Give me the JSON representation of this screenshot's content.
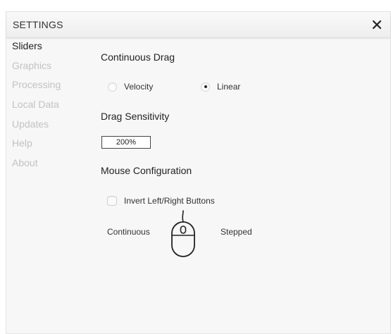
{
  "dialog": {
    "title": "SETTINGS",
    "close_icon": "close-icon"
  },
  "sidebar": {
    "items": [
      {
        "label": "Sliders",
        "active": true
      },
      {
        "label": "Graphics",
        "active": false
      },
      {
        "label": "Processing",
        "active": false
      },
      {
        "label": "Local Data",
        "active": false
      },
      {
        "label": "Updates",
        "active": false
      },
      {
        "label": "Help",
        "active": false
      },
      {
        "label": "About",
        "active": false
      }
    ]
  },
  "continuous_drag": {
    "title": "Continuous Drag",
    "options": [
      {
        "label": "Velocity",
        "selected": false
      },
      {
        "label": "Linear",
        "selected": true
      }
    ]
  },
  "drag_sensitivity": {
    "title": "Drag Sensitivity",
    "value": "200%"
  },
  "mouse_configuration": {
    "title": "Mouse Configuration",
    "invert_buttons": {
      "label": "Invert Left/Right Buttons",
      "checked": false
    },
    "left_mode": "Continuous",
    "right_mode": "Stepped",
    "mouse_icon": "mouse-icon"
  },
  "colors": {
    "active_text": "#222222",
    "inactive_text": "#c2c2c2",
    "panel_background": "#f7f7f7"
  }
}
